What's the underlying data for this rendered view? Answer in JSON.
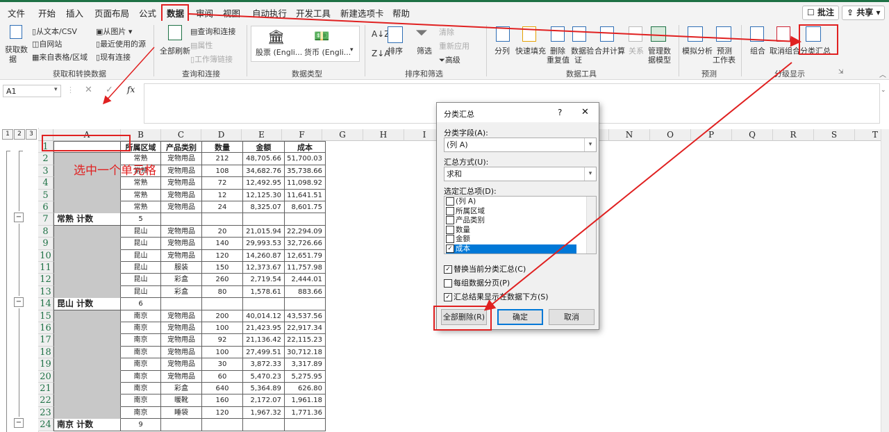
{
  "menu": {
    "items": [
      "文件",
      "开始",
      "插入",
      "页面布局",
      "公式",
      "数据",
      "审阅",
      "视图",
      "自动执行",
      "开发工具",
      "新建选项卡",
      "帮助"
    ],
    "comment_label": "批注",
    "share_label": "共享"
  },
  "ribbon": {
    "get_data": {
      "label1": "获取数",
      "label2": "据",
      "from_text": "从文本/CSV",
      "from_web": "自网站",
      "from_table": "来自表格/区域",
      "from_picture": "从图片",
      "recent_sources": "最近使用的源",
      "existing_conn": "现有连接",
      "group": "获取和转换数据"
    },
    "queries": {
      "refresh_all": "全部刷新",
      "queries_conn": "查询和连接",
      "properties": "属性",
      "edit_links": "工作簿链接",
      "group": "查询和连接"
    },
    "data_types": {
      "stocks": "股票 (Engli...",
      "currency": "货币 (Engli...",
      "group": "数据类型"
    },
    "sort_filter": {
      "sort": "排序",
      "filter": "筛选",
      "clear": "清除",
      "reapply": "重新应用",
      "advanced": "高级",
      "group": "排序和筛选"
    },
    "data_tools": {
      "split": "分列",
      "flash_fill": "快速填充",
      "remove_dup1": "删除",
      "remove_dup2": "重复值",
      "validation1": "数据验",
      "validation2": "证",
      "consolidate": "合并计算",
      "relations": "关系",
      "manage_model1": "管理数",
      "manage_model2": "据模型",
      "group": "数据工具"
    },
    "forecast": {
      "whatif": "模拟分析",
      "forecast1": "预测",
      "forecast2": "工作表",
      "group": "预测"
    },
    "outline": {
      "group_btn": "组合",
      "ungroup": "取消组合",
      "subtotal": "分类汇总",
      "group": "分级显示"
    }
  },
  "formula_bar": {
    "namebox": "A1",
    "fx": "fx"
  },
  "columns": [
    "A",
    "B",
    "C",
    "D",
    "E",
    "F",
    "G",
    "H",
    "I",
    "J",
    "K",
    "L",
    "M",
    "N",
    "O",
    "P",
    "Q",
    "R",
    "S",
    "T"
  ],
  "outline_levels": [
    "1",
    "2",
    "3"
  ],
  "table": {
    "headers": [
      "",
      "所属区域",
      "产品类别",
      "数量",
      "金额",
      "成本"
    ],
    "rows": [
      {
        "n": "2",
        "b": "常熟",
        "c": "宠物用品",
        "d": "212",
        "e": "48,705.66",
        "f": "51,700.03"
      },
      {
        "n": "3",
        "b": "常熟",
        "c": "宠物用品",
        "d": "108",
        "e": "34,682.76",
        "f": "35,738.66"
      },
      {
        "n": "4",
        "b": "常熟",
        "c": "宠物用品",
        "d": "72",
        "e": "12,492.95",
        "f": "11,098.92"
      },
      {
        "n": "5",
        "b": "常熟",
        "c": "宠物用品",
        "d": "12",
        "e": "12,125.30",
        "f": "11,641.51"
      },
      {
        "n": "6",
        "b": "常熟",
        "c": "宠物用品",
        "d": "24",
        "e": "8,325.07",
        "f": "8,601.75"
      },
      {
        "n": "7",
        "a": "常熟 计数",
        "b": "5",
        "total": true
      },
      {
        "n": "8",
        "b": "昆山",
        "c": "宠物用品",
        "d": "20",
        "e": "21,015.94",
        "f": "22,294.09"
      },
      {
        "n": "9",
        "b": "昆山",
        "c": "宠物用品",
        "d": "140",
        "e": "29,993.53",
        "f": "32,726.66"
      },
      {
        "n": "10",
        "b": "昆山",
        "c": "宠物用品",
        "d": "120",
        "e": "14,260.87",
        "f": "12,651.79"
      },
      {
        "n": "11",
        "b": "昆山",
        "c": "服装",
        "d": "150",
        "e": "12,373.67",
        "f": "11,757.98"
      },
      {
        "n": "12",
        "b": "昆山",
        "c": "彩盒",
        "d": "260",
        "e": "2,719.54",
        "f": "2,444.01"
      },
      {
        "n": "13",
        "b": "昆山",
        "c": "彩盒",
        "d": "80",
        "e": "1,578.61",
        "f": "883.66"
      },
      {
        "n": "14",
        "a": "昆山 计数",
        "b": "6",
        "total": true
      },
      {
        "n": "15",
        "b": "南京",
        "c": "宠物用品",
        "d": "200",
        "e": "40,014.12",
        "f": "43,537.56"
      },
      {
        "n": "16",
        "b": "南京",
        "c": "宠物用品",
        "d": "100",
        "e": "21,423.95",
        "f": "22,917.34"
      },
      {
        "n": "17",
        "b": "南京",
        "c": "宠物用品",
        "d": "92",
        "e": "21,136.42",
        "f": "22,115.23"
      },
      {
        "n": "18",
        "b": "南京",
        "c": "宠物用品",
        "d": "100",
        "e": "27,499.51",
        "f": "30,712.18"
      },
      {
        "n": "19",
        "b": "南京",
        "c": "宠物用品",
        "d": "30",
        "e": "3,872.33",
        "f": "3,317.89"
      },
      {
        "n": "20",
        "b": "南京",
        "c": "宠物用品",
        "d": "60",
        "e": "5,470.23",
        "f": "5,275.95"
      },
      {
        "n": "21",
        "b": "南京",
        "c": "彩盒",
        "d": "640",
        "e": "5,364.89",
        "f": "626.80"
      },
      {
        "n": "22",
        "b": "南京",
        "c": "暖靴",
        "d": "160",
        "e": "2,172.07",
        "f": "1,961.18"
      },
      {
        "n": "23",
        "b": "南京",
        "c": "睡袋",
        "d": "120",
        "e": "1,967.32",
        "f": "1,771.36"
      },
      {
        "n": "24",
        "a": "南京 计数",
        "b": "9",
        "total": true
      }
    ]
  },
  "annotation": "选中一个单元格",
  "dialog": {
    "title": "分类汇总",
    "help": "?",
    "close": "✕",
    "field_label": "分类字段(A):",
    "field_value": "(列 A)",
    "func_label": "汇总方式(U):",
    "func_value": "求和",
    "items_label": "选定汇总项(D):",
    "items": [
      {
        "label": "(列 A)",
        "checked": false
      },
      {
        "label": "所属区域",
        "checked": false
      },
      {
        "label": "产品类别",
        "checked": false
      },
      {
        "label": "数量",
        "checked": false
      },
      {
        "label": "金额",
        "checked": false
      },
      {
        "label": "成本",
        "checked": true
      }
    ],
    "opt_replace": "替换当前分类汇总(C)",
    "opt_pagebreak": "每组数据分页(P)",
    "opt_below": "汇总结果显示在数据下方(S)",
    "btn_remove_all": "全部删除(R)",
    "btn_ok": "确定",
    "btn_cancel": "取消"
  },
  "colors": {
    "accent_green": "#1e7145",
    "highlight_red": "#e02020",
    "selection_blue": "#0078d7"
  }
}
